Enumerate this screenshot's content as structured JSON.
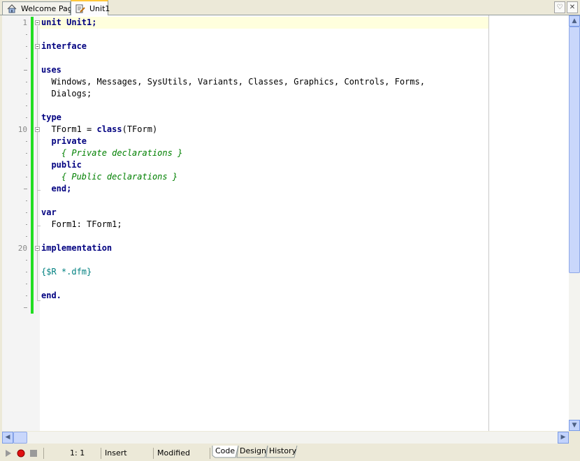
{
  "tabs": [
    {
      "label": "Welcome Page",
      "icon": "home-icon"
    },
    {
      "label": "Unit1",
      "icon": "unit-file-icon",
      "active": true
    }
  ],
  "tab_buttons": {
    "menu_glyph": "♡",
    "close_glyph": "✕"
  },
  "line_numbers": {
    "l1": "1",
    "l10": "10",
    "l20": "20"
  },
  "code": {
    "l1": "unit Unit1;",
    "l3": "interface",
    "l5": "uses",
    "l6": "  Windows, Messages, SysUtils, Variants, Classes, Graphics, Controls, Forms,",
    "l7": "  Dialogs;",
    "l9": "type",
    "l10a": "  TForm1 = ",
    "l10kw": "class",
    "l10b": "(TForm)",
    "l11": "  private",
    "l12": "    { Private declarations }",
    "l13": "  public",
    "l14": "    { Public declarations }",
    "l15": "  end;",
    "l17": "var",
    "l18": "  Form1: TForm1;",
    "l20": "implementation",
    "l22": "{$R *.dfm}",
    "l24": "end."
  },
  "status": {
    "position": "1:  1",
    "mode": "Insert",
    "state": "Modified"
  },
  "view_tabs": [
    "Code",
    "Design",
    "History"
  ],
  "colors": {
    "modified_bar": "#22dd22",
    "keyword": "#000080",
    "comment": "#008000",
    "directive": "#008080"
  }
}
